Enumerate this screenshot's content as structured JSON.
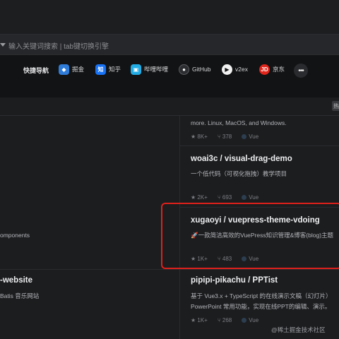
{
  "search": {
    "placeholder": "输入关键词搜索 | tab键切换引擎"
  },
  "quicknav": {
    "title": "快捷导航",
    "items": [
      {
        "label": "掘金",
        "icon": "juejin-icon"
      },
      {
        "label": "知乎",
        "icon": "zhihu-icon"
      },
      {
        "label": "哔哩哔哩",
        "icon": "bilibili-icon"
      },
      {
        "label": "GitHub",
        "icon": "github-icon"
      },
      {
        "label": "v2ex",
        "icon": "v2ex-icon"
      },
      {
        "label": "京东",
        "icon": "jd-icon"
      }
    ],
    "more": "•••"
  },
  "side_tag": "热",
  "left_cards": [
    {
      "desc": "omponents"
    },
    {
      "title": "-website",
      "desc": "Batis 音乐网站"
    }
  ],
  "right_cards": [
    {
      "desc": "more. Linux, MacOS, and Windows.",
      "stars": "★ 8K+",
      "forks": "⑂ 378",
      "lang": "Vue"
    },
    {
      "title": "woai3c / visual-drag-demo",
      "desc": "一个低代码（可视化拖拽）教学项目",
      "stars": "★ 2K+",
      "forks": "⑂ 693",
      "lang": "Vue"
    },
    {
      "title": "xugaoyi / vuepress-theme-vdoing",
      "desc": "🚀一款简洁高效的VuePress知识管理&博客(blog)主题",
      "stars": "★ 1K+",
      "forks": "⑂ 483",
      "lang": "Vue"
    },
    {
      "title": "pipipi-pikachu / PPTist",
      "desc": "基于 Vue3.x + TypeScript 的在线演示文稿（幻灯片）",
      "desc2": "PowerPoint 常用功能，实现在线PPT的编辑、演示。",
      "stars": "★ 1K+",
      "forks": "⑂ 268",
      "lang": "Vue"
    }
  ],
  "colors": {
    "highlight": "#e0201b",
    "vue_dot": "#2c3e50"
  },
  "watermark": "@稀土掘金技术社区"
}
